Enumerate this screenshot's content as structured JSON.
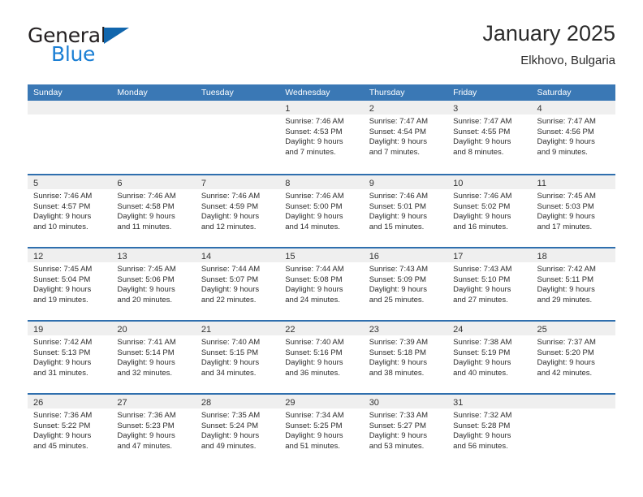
{
  "brand": {
    "name_part1": "General",
    "name_part2": "Blue",
    "triangle_color": "#1166ad",
    "blue_text_color": "#1b7fd4"
  },
  "header": {
    "title": "January 2025",
    "subtitle": "Elkhovo, Bulgaria"
  },
  "colors": {
    "header_blue": "#3a78b5",
    "row_divider_blue": "#2f6fae",
    "daynum_band": "#efefef",
    "text": "#2c2c2c"
  },
  "weekdays": [
    "Sunday",
    "Monday",
    "Tuesday",
    "Wednesday",
    "Thursday",
    "Friday",
    "Saturday"
  ],
  "labels": {
    "sunrise_prefix": "Sunrise: ",
    "sunset_prefix": "Sunset: ",
    "daylight_prefix": "Daylight: "
  },
  "weeks": [
    [
      {
        "empty": true
      },
      {
        "empty": true
      },
      {
        "empty": true
      },
      {
        "day": "1",
        "sunrise": "Sunrise: 7:46 AM",
        "sunset": "Sunset: 4:53 PM",
        "daylight_line1": "Daylight: 9 hours",
        "daylight_line2": "and 7 minutes."
      },
      {
        "day": "2",
        "sunrise": "Sunrise: 7:47 AM",
        "sunset": "Sunset: 4:54 PM",
        "daylight_line1": "Daylight: 9 hours",
        "daylight_line2": "and 7 minutes."
      },
      {
        "day": "3",
        "sunrise": "Sunrise: 7:47 AM",
        "sunset": "Sunset: 4:55 PM",
        "daylight_line1": "Daylight: 9 hours",
        "daylight_line2": "and 8 minutes."
      },
      {
        "day": "4",
        "sunrise": "Sunrise: 7:47 AM",
        "sunset": "Sunset: 4:56 PM",
        "daylight_line1": "Daylight: 9 hours",
        "daylight_line2": "and 9 minutes."
      }
    ],
    [
      {
        "day": "5",
        "sunrise": "Sunrise: 7:46 AM",
        "sunset": "Sunset: 4:57 PM",
        "daylight_line1": "Daylight: 9 hours",
        "daylight_line2": "and 10 minutes."
      },
      {
        "day": "6",
        "sunrise": "Sunrise: 7:46 AM",
        "sunset": "Sunset: 4:58 PM",
        "daylight_line1": "Daylight: 9 hours",
        "daylight_line2": "and 11 minutes."
      },
      {
        "day": "7",
        "sunrise": "Sunrise: 7:46 AM",
        "sunset": "Sunset: 4:59 PM",
        "daylight_line1": "Daylight: 9 hours",
        "daylight_line2": "and 12 minutes."
      },
      {
        "day": "8",
        "sunrise": "Sunrise: 7:46 AM",
        "sunset": "Sunset: 5:00 PM",
        "daylight_line1": "Daylight: 9 hours",
        "daylight_line2": "and 14 minutes."
      },
      {
        "day": "9",
        "sunrise": "Sunrise: 7:46 AM",
        "sunset": "Sunset: 5:01 PM",
        "daylight_line1": "Daylight: 9 hours",
        "daylight_line2": "and 15 minutes."
      },
      {
        "day": "10",
        "sunrise": "Sunrise: 7:46 AM",
        "sunset": "Sunset: 5:02 PM",
        "daylight_line1": "Daylight: 9 hours",
        "daylight_line2": "and 16 minutes."
      },
      {
        "day": "11",
        "sunrise": "Sunrise: 7:45 AM",
        "sunset": "Sunset: 5:03 PM",
        "daylight_line1": "Daylight: 9 hours",
        "daylight_line2": "and 17 minutes."
      }
    ],
    [
      {
        "day": "12",
        "sunrise": "Sunrise: 7:45 AM",
        "sunset": "Sunset: 5:04 PM",
        "daylight_line1": "Daylight: 9 hours",
        "daylight_line2": "and 19 minutes."
      },
      {
        "day": "13",
        "sunrise": "Sunrise: 7:45 AM",
        "sunset": "Sunset: 5:06 PM",
        "daylight_line1": "Daylight: 9 hours",
        "daylight_line2": "and 20 minutes."
      },
      {
        "day": "14",
        "sunrise": "Sunrise: 7:44 AM",
        "sunset": "Sunset: 5:07 PM",
        "daylight_line1": "Daylight: 9 hours",
        "daylight_line2": "and 22 minutes."
      },
      {
        "day": "15",
        "sunrise": "Sunrise: 7:44 AM",
        "sunset": "Sunset: 5:08 PM",
        "daylight_line1": "Daylight: 9 hours",
        "daylight_line2": "and 24 minutes."
      },
      {
        "day": "16",
        "sunrise": "Sunrise: 7:43 AM",
        "sunset": "Sunset: 5:09 PM",
        "daylight_line1": "Daylight: 9 hours",
        "daylight_line2": "and 25 minutes."
      },
      {
        "day": "17",
        "sunrise": "Sunrise: 7:43 AM",
        "sunset": "Sunset: 5:10 PM",
        "daylight_line1": "Daylight: 9 hours",
        "daylight_line2": "and 27 minutes."
      },
      {
        "day": "18",
        "sunrise": "Sunrise: 7:42 AM",
        "sunset": "Sunset: 5:11 PM",
        "daylight_line1": "Daylight: 9 hours",
        "daylight_line2": "and 29 minutes."
      }
    ],
    [
      {
        "day": "19",
        "sunrise": "Sunrise: 7:42 AM",
        "sunset": "Sunset: 5:13 PM",
        "daylight_line1": "Daylight: 9 hours",
        "daylight_line2": "and 31 minutes."
      },
      {
        "day": "20",
        "sunrise": "Sunrise: 7:41 AM",
        "sunset": "Sunset: 5:14 PM",
        "daylight_line1": "Daylight: 9 hours",
        "daylight_line2": "and 32 minutes."
      },
      {
        "day": "21",
        "sunrise": "Sunrise: 7:40 AM",
        "sunset": "Sunset: 5:15 PM",
        "daylight_line1": "Daylight: 9 hours",
        "daylight_line2": "and 34 minutes."
      },
      {
        "day": "22",
        "sunrise": "Sunrise: 7:40 AM",
        "sunset": "Sunset: 5:16 PM",
        "daylight_line1": "Daylight: 9 hours",
        "daylight_line2": "and 36 minutes."
      },
      {
        "day": "23",
        "sunrise": "Sunrise: 7:39 AM",
        "sunset": "Sunset: 5:18 PM",
        "daylight_line1": "Daylight: 9 hours",
        "daylight_line2": "and 38 minutes."
      },
      {
        "day": "24",
        "sunrise": "Sunrise: 7:38 AM",
        "sunset": "Sunset: 5:19 PM",
        "daylight_line1": "Daylight: 9 hours",
        "daylight_line2": "and 40 minutes."
      },
      {
        "day": "25",
        "sunrise": "Sunrise: 7:37 AM",
        "sunset": "Sunset: 5:20 PM",
        "daylight_line1": "Daylight: 9 hours",
        "daylight_line2": "and 42 minutes."
      }
    ],
    [
      {
        "day": "26",
        "sunrise": "Sunrise: 7:36 AM",
        "sunset": "Sunset: 5:22 PM",
        "daylight_line1": "Daylight: 9 hours",
        "daylight_line2": "and 45 minutes."
      },
      {
        "day": "27",
        "sunrise": "Sunrise: 7:36 AM",
        "sunset": "Sunset: 5:23 PM",
        "daylight_line1": "Daylight: 9 hours",
        "daylight_line2": "and 47 minutes."
      },
      {
        "day": "28",
        "sunrise": "Sunrise: 7:35 AM",
        "sunset": "Sunset: 5:24 PM",
        "daylight_line1": "Daylight: 9 hours",
        "daylight_line2": "and 49 minutes."
      },
      {
        "day": "29",
        "sunrise": "Sunrise: 7:34 AM",
        "sunset": "Sunset: 5:25 PM",
        "daylight_line1": "Daylight: 9 hours",
        "daylight_line2": "and 51 minutes."
      },
      {
        "day": "30",
        "sunrise": "Sunrise: 7:33 AM",
        "sunset": "Sunset: 5:27 PM",
        "daylight_line1": "Daylight: 9 hours",
        "daylight_line2": "and 53 minutes."
      },
      {
        "day": "31",
        "sunrise": "Sunrise: 7:32 AM",
        "sunset": "Sunset: 5:28 PM",
        "daylight_line1": "Daylight: 9 hours",
        "daylight_line2": "and 56 minutes."
      },
      {
        "empty": true
      }
    ]
  ]
}
